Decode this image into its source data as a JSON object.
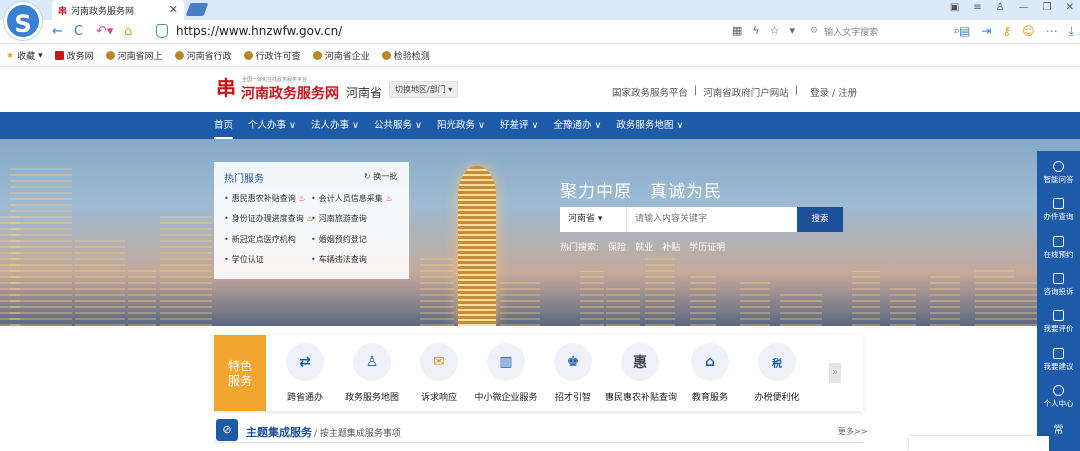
{
  "browser": {
    "tab_title": "河南政务服务网",
    "close_glyph": "✕",
    "url": "https://www.hnzwfw.gov.cn/",
    "search_placeholder": "输入文字搜索",
    "bookmarks": [
      "收藏",
      "政务网",
      "河南省网上",
      "河南省行政",
      "行政许可查",
      "河南省企业",
      "检验检测"
    ]
  },
  "site": {
    "logo_small": "全国一体化在线政务服务平台",
    "name": "河南政务服务网",
    "province": "河南省",
    "switch_label": "切换地区/部门 ▾",
    "top_links": [
      "国家政务服务平台",
      "|",
      "河南省政府门户网站",
      "|",
      "登录 / 注册"
    ]
  },
  "nav": {
    "items": [
      "首页",
      "个人办事 ∨",
      "法人办事 ∨",
      "公共服务 ∨",
      "阳光政务 ∨",
      "好差评 ∨",
      "全豫通办 ∨",
      "政务服务地图 ∨"
    ]
  },
  "hot": {
    "title": "热门服务",
    "refresh": "换一批",
    "items": [
      "惠民惠农补贴查询",
      "会计人员信息采集",
      "身份证办理进度查询",
      "河南旅游查询",
      "新冠定点医疗机构",
      "婚姻预约登记",
      "学位认证",
      "车辆违法查询"
    ]
  },
  "banner": {
    "slogan": "聚力中原　真诚为民",
    "search_select": "河南省 ▾",
    "search_placeholder": "请输入内容关键字",
    "search_button": "搜索",
    "hot_search_label": "热门搜索:",
    "hot_search": [
      "保险",
      "就业",
      "补贴",
      "学历证明"
    ]
  },
  "sidebar": [
    "智能问答",
    "办件查询",
    "在线预约",
    "咨询投诉",
    "我要评价",
    "我要建议",
    "个人中心",
    "常"
  ],
  "features": {
    "tag": "特色服务",
    "items": [
      "跨省通办",
      "政务服务地图",
      "诉求响应",
      "中小微企业服务",
      "招才引智",
      "惠民惠农补贴查询",
      "教育服务",
      "办税便利化"
    ],
    "next": "»"
  },
  "theme": {
    "title": "主题集成服务",
    "subtitle": "/ 按主题集成服务事项",
    "more": "更多>>"
  }
}
